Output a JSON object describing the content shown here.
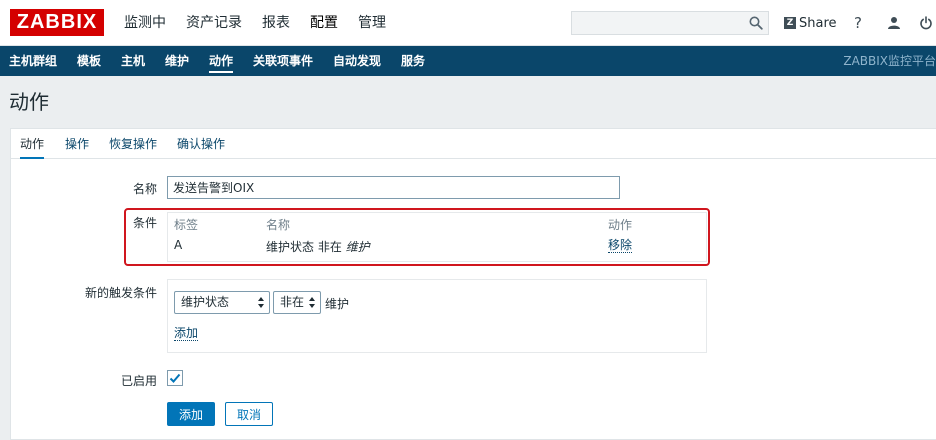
{
  "header": {
    "logo": "ZABBIX",
    "main_menu": [
      "监测中",
      "资产记录",
      "报表",
      "配置",
      "管理"
    ],
    "active_main": "配置",
    "search_value": "",
    "share_label": "Share",
    "help_glyph": "?"
  },
  "submenu": {
    "items": [
      "主机群组",
      "模板",
      "主机",
      "维护",
      "动作",
      "关联项事件",
      "自动发现",
      "服务"
    ],
    "active": "动作",
    "brand": "ZABBIX监控平台"
  },
  "page": {
    "title": "动作"
  },
  "tabs": [
    "动作",
    "操作",
    "恢复操作",
    "确认操作"
  ],
  "form": {
    "name_label": "名称",
    "name_value": "发送告警到OIX",
    "conditions_label": "条件",
    "conditions": {
      "headers": {
        "label": "标签",
        "name": "名称",
        "action": "动作"
      },
      "rows": [
        {
          "label": "A",
          "name_prefix": "维护状态 非在 ",
          "name_italic": "维护",
          "action": "移除"
        }
      ]
    },
    "new_condition_label": "新的触发条件",
    "new_condition": {
      "type_select": "维护状态",
      "operator_select": "非在",
      "value_text": "维护",
      "add_link": "添加"
    },
    "enabled_label": "已启用",
    "enabled": true,
    "add_button": "添加",
    "cancel_button": "取消"
  },
  "colors": {
    "logo_red": "#d40000",
    "submenu_bg": "#0a466a",
    "primary_blue": "#0275b8",
    "highlight_red": "#d0161e"
  }
}
